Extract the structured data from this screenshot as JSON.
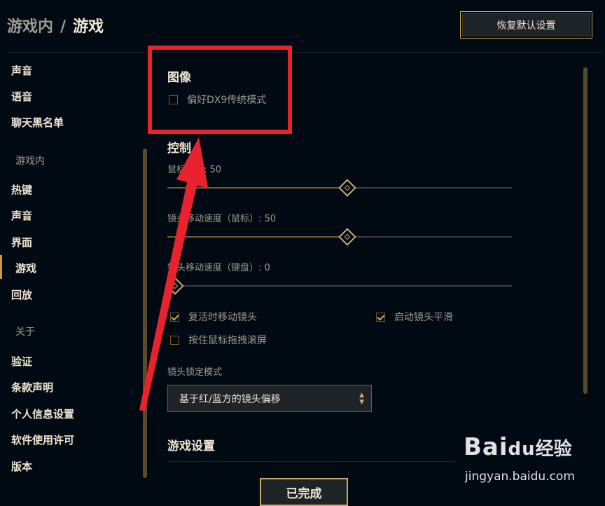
{
  "header": {
    "breadcrumb_parent": "游戏内",
    "breadcrumb_sep": "/",
    "breadcrumb_current": "游戏",
    "restore_label": "恢复默认设置"
  },
  "sidebar": {
    "top_items": [
      "声音",
      "语音",
      "聊天黑名单"
    ],
    "section_ingame": "游戏内",
    "ingame_items": [
      "热键",
      "声音",
      "界面",
      "游戏",
      "回放"
    ],
    "section_about": "关于",
    "about_items": [
      "验证",
      "条款声明",
      "个人信息设置",
      "软件使用许可",
      "版本"
    ],
    "active_item": "游戏"
  },
  "main": {
    "graphics_title": "图像",
    "dx9_label": "偏好DX9传统模式",
    "dx9_checked": false,
    "controls_title": "控制",
    "mouse_speed_label": "鼠标速度: 50",
    "mouse_speed_value": 50,
    "camera_mouse_label": "镜头移动速度（鼠标）: 50",
    "camera_mouse_value": 50,
    "camera_keyboard_label": "镜头移动速度（键盘）: 0",
    "camera_keyboard_value": 0,
    "respawn_camera_label": "复活时移动镜头",
    "respawn_camera_checked": true,
    "smooth_camera_label": "启动镜头平滑",
    "smooth_camera_checked": true,
    "drag_scroll_label": "按住鼠标拖拽滚屏",
    "drag_scroll_checked": false,
    "lock_mode_label": "镜头锁定模式",
    "lock_mode_value": "基于红/蓝方的镜头偏移",
    "game_settings_title": "游戏设置"
  },
  "footer": {
    "done_label": "已完成"
  },
  "watermark": {
    "brand": "Bai",
    "brand_du": "du",
    "brand_cn": "经验",
    "url": "jingyan.baidu.com"
  },
  "colors": {
    "gold": "#c8aa6e",
    "background": "#010a13",
    "highlight_red": "#e8232e"
  }
}
